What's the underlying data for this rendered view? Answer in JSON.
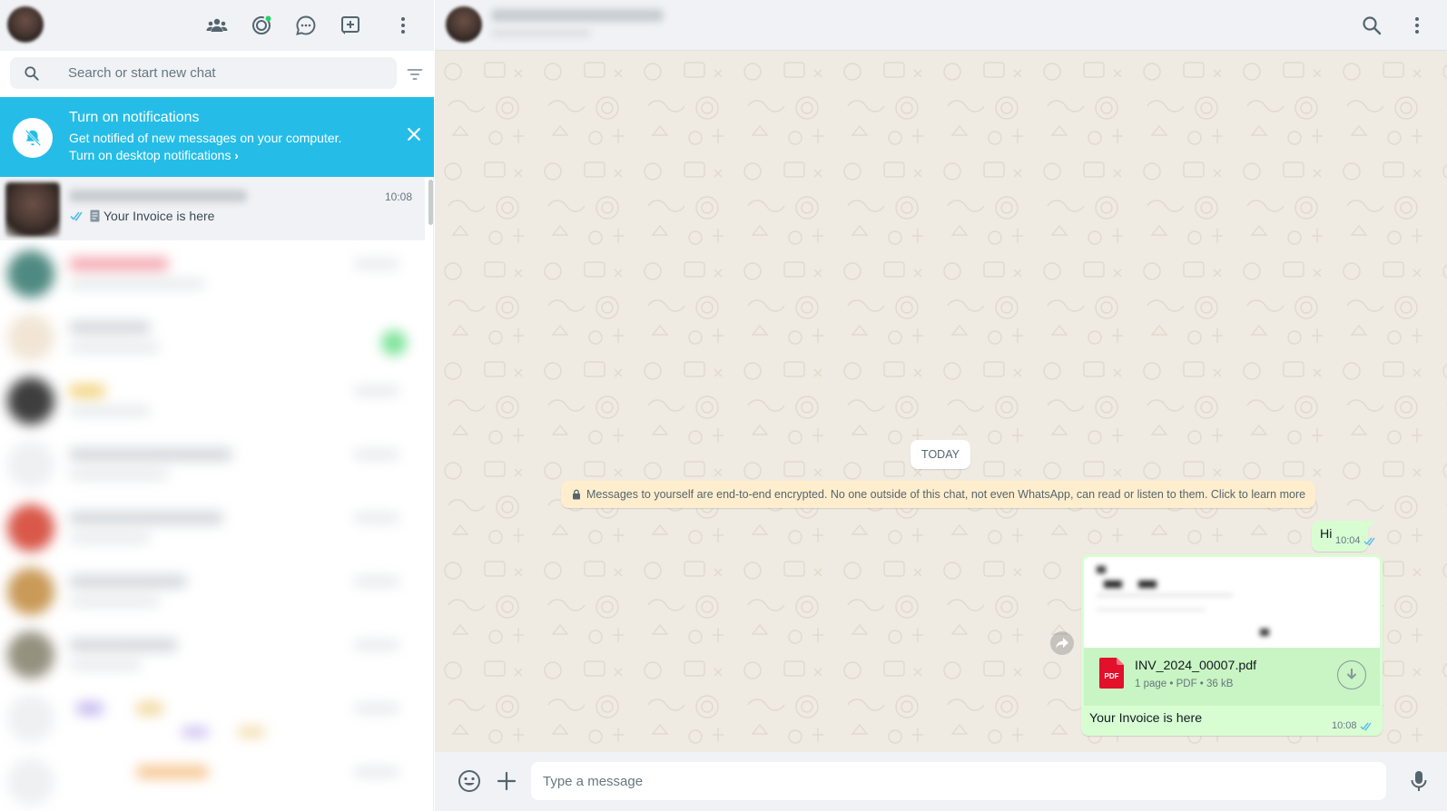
{
  "search": {
    "placeholder": "Search or start new chat"
  },
  "notification": {
    "title": "Turn on notifications",
    "subtitle": "Get notified of new messages on your computer.",
    "link": "Turn on desktop notifications"
  },
  "chat_list": {
    "active": {
      "time": "10:08",
      "preview": "Your Invoice is here"
    }
  },
  "conversation": {
    "date_chip": "TODAY",
    "encryption_note": "Messages to yourself are end-to-end encrypted. No one outside of this chat, not even WhatsApp, can read or listen to them. Click to learn more",
    "messages": [
      {
        "text": "Hi",
        "time": "10:04"
      },
      {
        "file_name": "INV_2024_00007.pdf",
        "file_info": "1 page • PDF • 36 kB",
        "pdf_badge": "PDF",
        "caption": "Your Invoice is here",
        "time": "10:08"
      }
    ]
  },
  "composer": {
    "placeholder": "Type a message"
  },
  "colors": {
    "header_bg": "#f0f2f5",
    "notification_bg": "#25bde7",
    "outgoing_bubble": "#d9fdd3",
    "wallpaper": "#efeae2",
    "read_tick": "#53bdeb",
    "icon": "#54656f"
  },
  "icons": [
    "communities-icon",
    "status-icon",
    "channels-icon",
    "new-chat-icon",
    "menu-icon",
    "search-icon",
    "filter-icon",
    "bell-off-icon",
    "close-icon",
    "double-check-icon",
    "document-icon",
    "pdf-icon",
    "download-icon",
    "forward-icon",
    "emoji-icon",
    "plus-icon",
    "mic-icon"
  ]
}
